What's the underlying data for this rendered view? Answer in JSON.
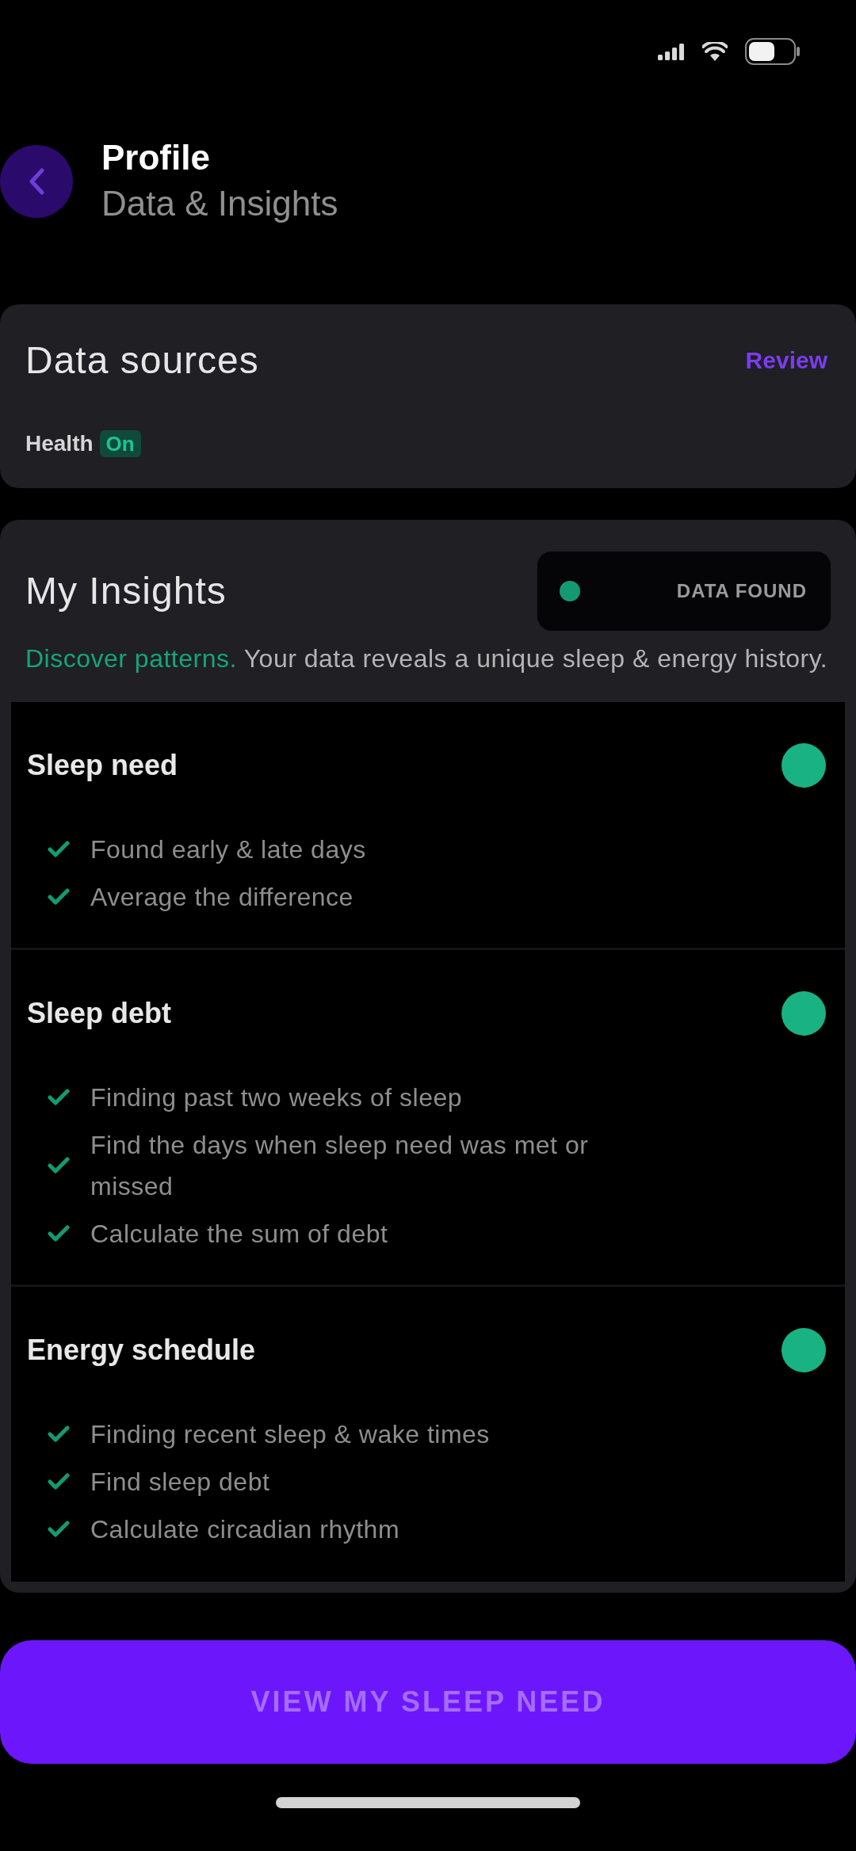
{
  "header": {
    "title": "Profile",
    "subtitle": "Data & Insights"
  },
  "data_sources": {
    "title": "Data sources",
    "action": "Review",
    "source": {
      "name": "Health",
      "status": "On"
    }
  },
  "insights": {
    "title": "My Insights",
    "badge": {
      "label": "DATA FOUND"
    },
    "description": {
      "lead": "Discover patterns.",
      "text": "Your data reveals a unique sleep & energy history."
    },
    "sections": [
      {
        "title": "Sleep need",
        "complete": true,
        "steps": [
          {
            "label": "Found early & late days",
            "done": true
          },
          {
            "label": "Average the difference",
            "done": true
          }
        ]
      },
      {
        "title": "Sleep debt",
        "complete": true,
        "steps": [
          {
            "label": "Finding past two weeks of sleep",
            "done": true
          },
          {
            "label": "Find the days when sleep need was met or missed",
            "done": true
          },
          {
            "label": "Calculate the sum of debt",
            "done": true
          }
        ]
      },
      {
        "title": "Energy schedule",
        "complete": true,
        "steps": [
          {
            "label": "Finding recent sleep & wake times",
            "done": true
          },
          {
            "label": "Find sleep debt",
            "done": true
          },
          {
            "label": "Calculate circadian rhythm",
            "done": true
          }
        ]
      }
    ]
  },
  "primary_button": {
    "label": "VIEW MY SLEEP NEED"
  }
}
